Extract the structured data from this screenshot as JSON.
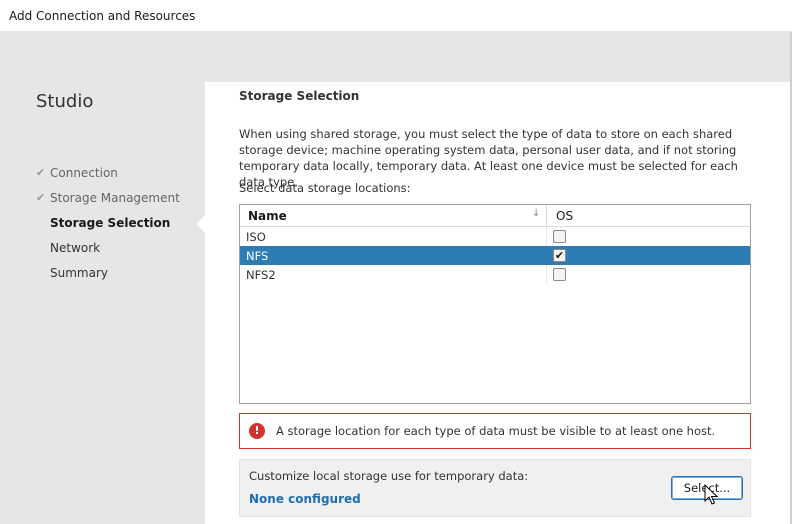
{
  "window": {
    "title": "Add Connection and Resources"
  },
  "sidebar": {
    "app_name": "Studio",
    "items": [
      {
        "label": "Connection",
        "check": "✔"
      },
      {
        "label": "Storage Management",
        "check": "✔"
      },
      {
        "label": "Storage Selection"
      },
      {
        "label": "Network"
      },
      {
        "label": "Summary"
      }
    ]
  },
  "main": {
    "heading": "Storage Selection",
    "description": "When using shared storage, you must select the type of data to store on each shared storage device; machine operating system data, personal user data, and if not storing temporary data locally, temporary data. At least one device must be selected for each data type.",
    "select_label": "Select data storage locations:",
    "table": {
      "columns": {
        "name": "Name",
        "sort_icon": "↓",
        "os": "OS"
      },
      "rows": [
        {
          "name": "ISO",
          "os_checked": false,
          "check": ""
        },
        {
          "name": "NFS",
          "os_checked": true,
          "check": "✔"
        },
        {
          "name": "NFS2",
          "os_checked": false,
          "check": ""
        }
      ],
      "selected_row": "NFS"
    },
    "alert": {
      "icon": "!",
      "message": "A storage location for each type of data must be visible to at least one host."
    },
    "temp_storage": {
      "label": "Customize local storage use for temporary data:",
      "value": "None configured",
      "button_label": "Select..."
    }
  },
  "colors": {
    "selection": "#2d7db5",
    "error": "#d0342c",
    "link": "#1f6fb2"
  }
}
